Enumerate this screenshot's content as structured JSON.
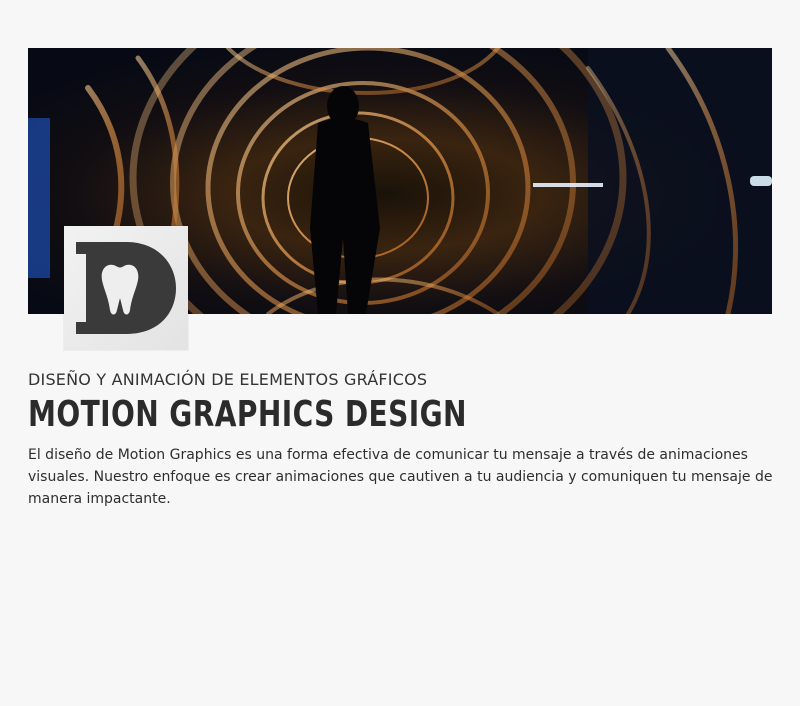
{
  "hero": {
    "image_name": "light-painting-spiral-photo",
    "logo_letter": "D"
  },
  "content": {
    "subtitle": "DISEÑO Y ANIMACIÓN DE ELEMENTOS GRÁFICOS",
    "title": "MOTION GRAPHICS DESIGN",
    "description": "El diseño de Motion Graphics es una forma efectiva de comunicar tu mensaje a través de animaciones visuales. Nuestro enfoque es crear animaciones que cautiven a tu audiencia y comuniquen tu mensaje de manera impactante."
  },
  "colors": {
    "background": "#f7f7f7",
    "heading": "#2b2b2b",
    "text": "#2e2e2e",
    "logo_dark": "#3a3a3a"
  }
}
